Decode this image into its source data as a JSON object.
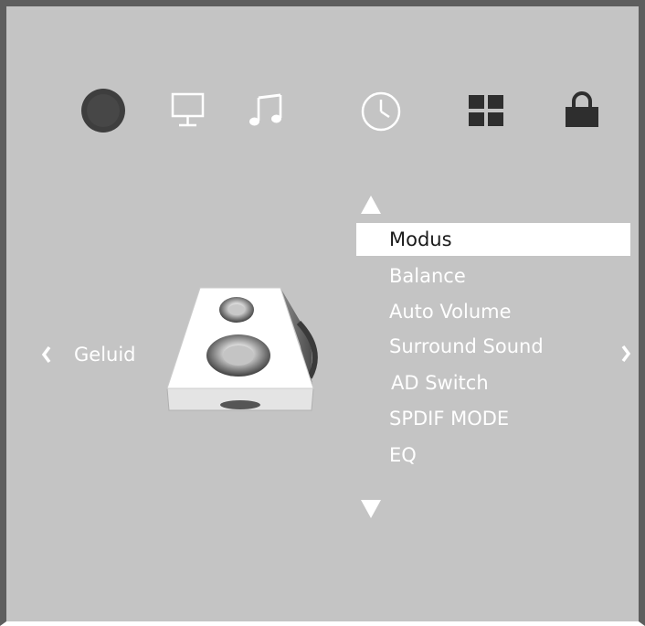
{
  "top_icons": [
    {
      "name": "picture-icon",
      "active": true
    },
    {
      "name": "screen-icon",
      "active": false
    },
    {
      "name": "music-note-icon",
      "active": false
    },
    {
      "name": "clock-icon",
      "active": false
    },
    {
      "name": "grid-icon",
      "active": false
    },
    {
      "name": "lock-icon",
      "active": false
    }
  ],
  "category": {
    "label": "Geluid",
    "icon": "speaker-icon",
    "prev_icon": "chevron-left-icon",
    "next_icon": "chevron-right-icon"
  },
  "menu": {
    "items": [
      {
        "label": "Modus",
        "selected": true
      },
      {
        "label": "Balance",
        "selected": false
      },
      {
        "label": "Auto Volume",
        "selected": false
      },
      {
        "label": "Surround Sound",
        "selected": false
      },
      {
        "label": "AD Switch",
        "selected": false
      },
      {
        "label": "SPDIF MODE",
        "selected": false
      },
      {
        "label": "EQ",
        "selected": false
      }
    ],
    "scroll_up_icon": "triangle-up-icon",
    "scroll_down_icon": "triangle-down-icon"
  },
  "colors": {
    "background": "#c4c4c4",
    "frame": "#5e5e5e",
    "text": "#ffffff",
    "selected_bg": "#ffffff",
    "selected_text": "#1a1a1a",
    "icon_dark": "#2e2e2e"
  }
}
